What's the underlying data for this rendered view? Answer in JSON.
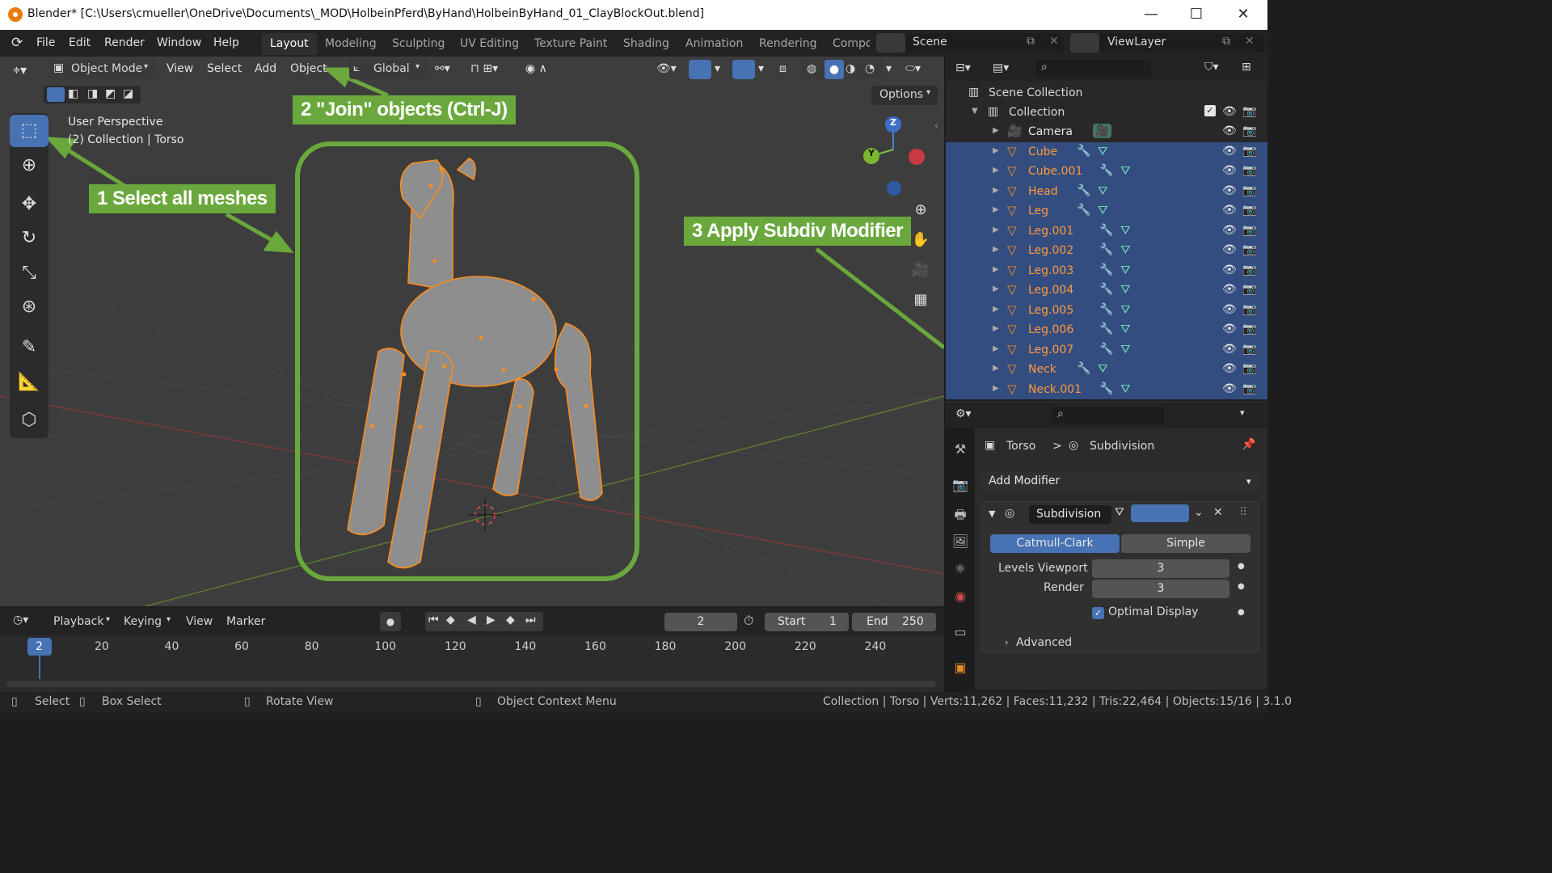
{
  "window": {
    "title": "Blender* [C:\\Users\\cmueller\\OneDrive\\Documents\\_MOD\\HolbeinPferd\\ByHand\\HolbeinByHand_01_ClayBlockOut.blend]",
    "min": "—",
    "max": "☐",
    "close": "✕"
  },
  "menu": {
    "items": [
      "File",
      "Edit",
      "Render",
      "Window",
      "Help"
    ],
    "workspaces": [
      "Layout",
      "Modeling",
      "Sculpting",
      "UV Editing",
      "Texture Paint",
      "Shading",
      "Animation",
      "Rendering",
      "Compo"
    ],
    "scene_label": "Scene",
    "viewlayer_label": "ViewLayer"
  },
  "viewport": {
    "mode": "Object Mode",
    "menu": [
      "View",
      "Select",
      "Add",
      "Object"
    ],
    "orientation": "Global",
    "options": "Options",
    "overlay_line1": "User Perspective",
    "overlay_line2": "(2) Collection | Torso",
    "gizmo": {
      "z": "Z",
      "y": "Y"
    }
  },
  "callouts": {
    "c1": "1 Select all meshes",
    "c2": "2 \"Join\" objects (Ctrl-J)",
    "c3": "3 Apply Subdiv Modifier"
  },
  "colors": {
    "callout": "#6aa83d",
    "selection": "#ff8c1a",
    "active_blue": "#4772b3",
    "outliner_sel": "#334d80"
  },
  "outliner": {
    "scene_collection": "Scene Collection",
    "collection": "Collection",
    "items": [
      {
        "name": "Camera",
        "kind": "camera"
      },
      {
        "name": "Cube",
        "kind": "mesh"
      },
      {
        "name": "Cube.001",
        "kind": "mesh"
      },
      {
        "name": "Head",
        "kind": "mesh"
      },
      {
        "name": "Leg",
        "kind": "mesh"
      },
      {
        "name": "Leg.001",
        "kind": "mesh"
      },
      {
        "name": "Leg.002",
        "kind": "mesh"
      },
      {
        "name": "Leg.003",
        "kind": "mesh"
      },
      {
        "name": "Leg.004",
        "kind": "mesh"
      },
      {
        "name": "Leg.005",
        "kind": "mesh"
      },
      {
        "name": "Leg.006",
        "kind": "mesh"
      },
      {
        "name": "Leg.007",
        "kind": "mesh"
      },
      {
        "name": "Neck",
        "kind": "mesh"
      },
      {
        "name": "Neck.001",
        "kind": "mesh"
      }
    ]
  },
  "properties": {
    "breadcrumb_object": "Torso",
    "breadcrumb_sep": ">",
    "breadcrumb_modifier": "Subdivision",
    "add_modifier": "Add Modifier",
    "modifier_name": "Subdivision",
    "tab_catmull": "Catmull-Clark",
    "tab_simple": "Simple",
    "levels_viewport_label": "Levels Viewport",
    "levels_viewport_value": "3",
    "render_label": "Render",
    "render_value": "3",
    "optimal_display": "Optimal Display",
    "advanced": "Advanced"
  },
  "timeline": {
    "menu": [
      "Playback",
      "Keying",
      "View",
      "Marker"
    ],
    "current_frame": "2",
    "start_label": "Start",
    "start_value": "1",
    "end_label": "End",
    "end_value": "250",
    "ruler": [
      "2",
      "20",
      "40",
      "60",
      "80",
      "100",
      "120",
      "140",
      "160",
      "180",
      "200",
      "220",
      "240"
    ]
  },
  "status": {
    "select": "Select",
    "box_select": "Box Select",
    "rotate_view": "Rotate View",
    "context_menu": "Object Context Menu",
    "stats": "Collection | Torso | Verts:11,262 | Faces:11,232 | Tris:22,464 | Objects:15/16 | 3.1.0"
  }
}
